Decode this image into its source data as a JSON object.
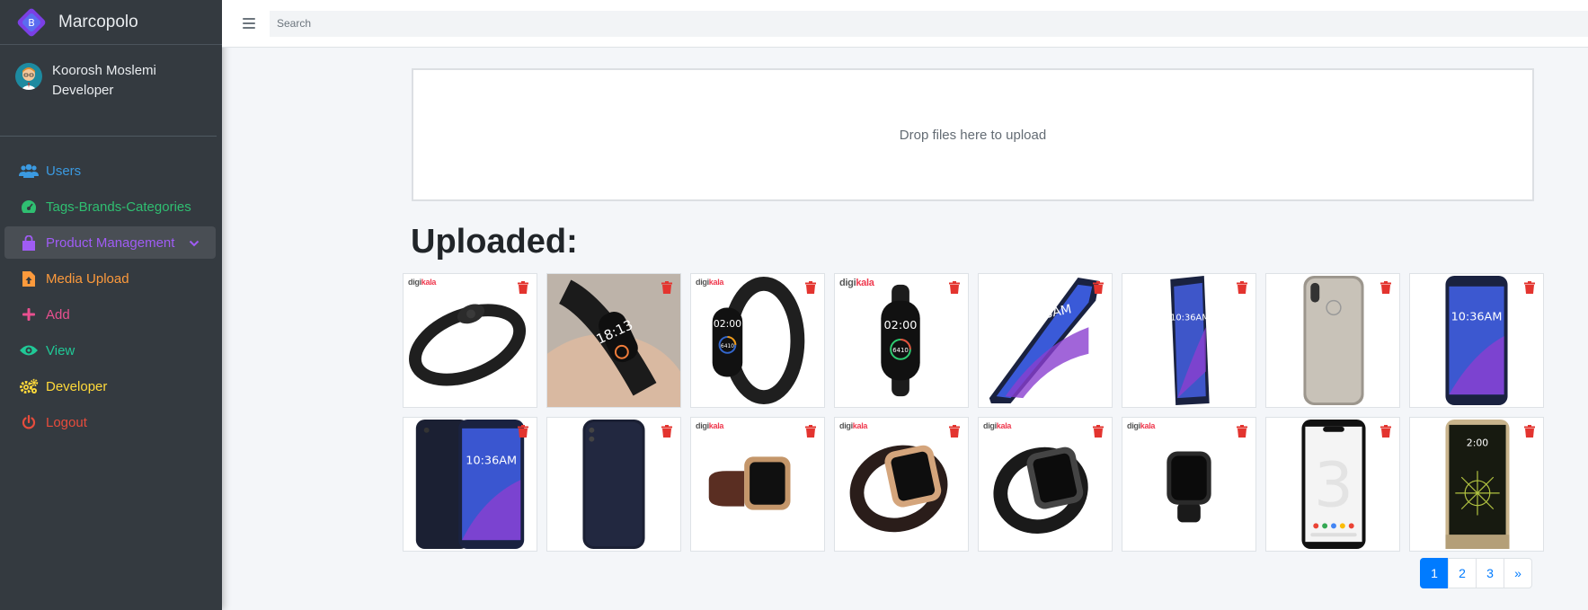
{
  "brand": {
    "name": "Marcopolo"
  },
  "user": {
    "name": "Koorosh Moslemi",
    "role": "Developer"
  },
  "sidebar": {
    "items": [
      {
        "label": "Users",
        "icon": "users-icon",
        "color": "#3b9ae1"
      },
      {
        "label": "Tags-Brands-Categories",
        "icon": "tachometer-icon",
        "color": "#2fbf71"
      },
      {
        "label": "Product Management",
        "icon": "shopping-bag-icon",
        "color": "#a05cf5",
        "active": true
      },
      {
        "label": "Media Upload",
        "icon": "file-upload-icon",
        "color": "#fd9a3c"
      },
      {
        "label": "Add",
        "icon": "plus-icon",
        "color": "#e8508f"
      },
      {
        "label": "View",
        "icon": "eye-icon",
        "color": "#20c997"
      },
      {
        "label": "Developer",
        "icon": "cogs-icon",
        "color": "#ffd93a"
      },
      {
        "label": "Logout",
        "icon": "power-icon",
        "color": "#e74c3c"
      }
    ]
  },
  "topbar": {
    "search_placeholder": "Search"
  },
  "dropzone": {
    "message": "Drop files here to upload"
  },
  "uploaded": {
    "title": "Uploaded:",
    "images": [
      {
        "subject": "black fitness band",
        "watermark": true
      },
      {
        "subject": "smart band on hand",
        "watermark": false
      },
      {
        "subject": "smart band display 02:00",
        "watermark": true
      },
      {
        "subject": "smart band front 02:00",
        "watermark": true
      },
      {
        "subject": "smartphone angled 10:36 AM",
        "watermark": false
      },
      {
        "subject": "smartphone angled 10:36 AM",
        "watermark": false
      },
      {
        "subject": "smartphone back silver",
        "watermark": false
      },
      {
        "subject": "smartphone front 10:36 AM",
        "watermark": false
      },
      {
        "subject": "smartphone front and back 10:36 AM",
        "watermark": false
      },
      {
        "subject": "smartphone back dark",
        "watermark": false
      },
      {
        "subject": "smartwatch brown strap",
        "watermark": true
      },
      {
        "subject": "smartwatch gold angled",
        "watermark": true
      },
      {
        "subject": "smartwatch black angled",
        "watermark": true
      },
      {
        "subject": "smartwatch black front",
        "watermark": true
      },
      {
        "subject": "pixel phone front",
        "watermark": false
      },
      {
        "subject": "lg phone gold 2:00",
        "watermark": false
      }
    ],
    "watermark_text": {
      "prefix": "digi",
      "suffix": "kala"
    }
  },
  "screen_text": {
    "clock_1036": "10:36AM",
    "clock_0200": "02:00",
    "clock_200": "2:00",
    "band_steps": "6410",
    "hand_time": "18:13"
  },
  "pagination": {
    "pages": [
      "1",
      "2",
      "3"
    ],
    "next": "»",
    "current": "1"
  }
}
